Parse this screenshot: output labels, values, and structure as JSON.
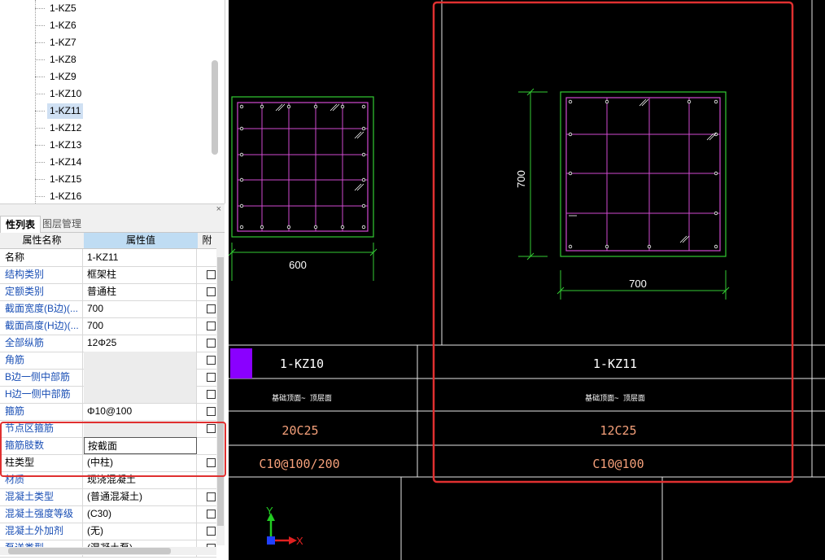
{
  "tree": {
    "items": [
      "1-KZ5",
      "1-KZ6",
      "1-KZ7",
      "1-KZ8",
      "1-KZ9",
      "1-KZ10",
      "1-KZ11",
      "1-KZ12",
      "1-KZ13",
      "1-KZ14",
      "1-KZ15",
      "1-KZ16"
    ],
    "selected_index": 6
  },
  "tabs": {
    "active": "性列表",
    "inactive": "图层管理"
  },
  "grid": {
    "col_name": "属性名称",
    "col_value": "属性值",
    "col_extra": "附",
    "rows": [
      {
        "name": "名称",
        "value": "1-KZ11"
      },
      {
        "name": "结构类别",
        "value": "框架柱"
      },
      {
        "name": "定额类别",
        "value": "普通柱"
      },
      {
        "name": "截面宽度(B边)(...",
        "value": "700"
      },
      {
        "name": "截面高度(H边)(...",
        "value": "700"
      },
      {
        "name": "全部纵筋",
        "value": "12Φ25"
      },
      {
        "name": "角筋",
        "value": ""
      },
      {
        "name": "B边一侧中部筋",
        "value": ""
      },
      {
        "name": "H边一侧中部筋",
        "value": ""
      },
      {
        "name": "箍筋",
        "value": "Φ10@100"
      },
      {
        "name": "节点区箍筋",
        "value": ""
      },
      {
        "name": "箍筋肢数",
        "value": "按截面"
      },
      {
        "name": "柱类型",
        "value": "(中柱)"
      },
      {
        "name": "材质",
        "value": "现浇混凝土"
      },
      {
        "name": "混凝土类型",
        "value": "(普通混凝土)"
      },
      {
        "name": "混凝土强度等级",
        "value": "(C30)"
      },
      {
        "name": "混凝土外加剂",
        "value": "(无)"
      },
      {
        "name": "泵送类型",
        "value": "(混凝土泵)"
      }
    ]
  },
  "cad": {
    "left_col": {
      "width_dim": "600",
      "name": "1-KZ10",
      "range": "基础顶面~ 顶层面",
      "rebar": "20C25",
      "stirrup": "C10@100/200"
    },
    "right_col": {
      "width_dim": "700",
      "height_dim": "700",
      "name": "1-KZ11",
      "range": "基础顶面~ 顶层面",
      "rebar": "12C25",
      "stirrup": "C10@100"
    },
    "axis_x": "X",
    "axis_y": "Y"
  },
  "colors": {
    "rebar": "#d04ad0",
    "outline": "#33cc33",
    "highlight": "#e03030",
    "selected_swatch": "#8a00ff",
    "spec_text": "#f5a07a"
  }
}
